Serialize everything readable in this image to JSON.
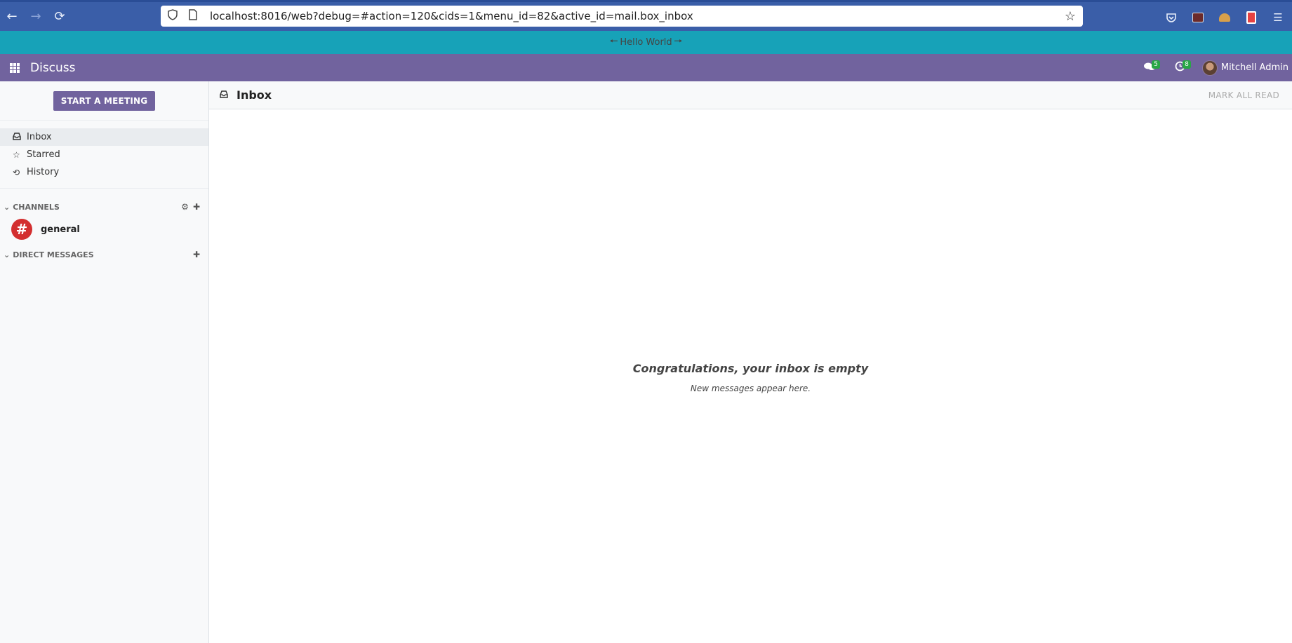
{
  "browser": {
    "url": "localhost:8016/web?debug=#action=120&cids=1&menu_id=82&active_id=mail.box_inbox"
  },
  "banner": {
    "text": "Hello World",
    "left_arrow": "🡐",
    "right_arrow": "🡒"
  },
  "navbar": {
    "app_title": "Discuss",
    "messages_badge": "5",
    "activities_badge": "8",
    "user_name": "Mitchell Admin"
  },
  "sidebar": {
    "start_meeting_label": "START A MEETING",
    "mailboxes": [
      {
        "label": "Inbox",
        "icon": "inbox-icon",
        "active": true
      },
      {
        "label": "Starred",
        "icon": "star-icon",
        "active": false
      },
      {
        "label": "History",
        "icon": "history-icon",
        "active": false
      }
    ],
    "channels_header": "CHANNELS",
    "channels": [
      {
        "name": "general",
        "symbol": "#",
        "color": "#d32f2f"
      }
    ],
    "direct_messages_header": "DIRECT MESSAGES"
  },
  "content": {
    "title": "Inbox",
    "mark_all_read_label": "MARK ALL READ",
    "empty_title": "Congratulations, your inbox is empty",
    "empty_subtitle": "New messages appear here."
  },
  "colors": {
    "brand": "#71639e",
    "banner": "#17a2b8",
    "browser": "#3a5ea8",
    "badge": "#28a745"
  }
}
